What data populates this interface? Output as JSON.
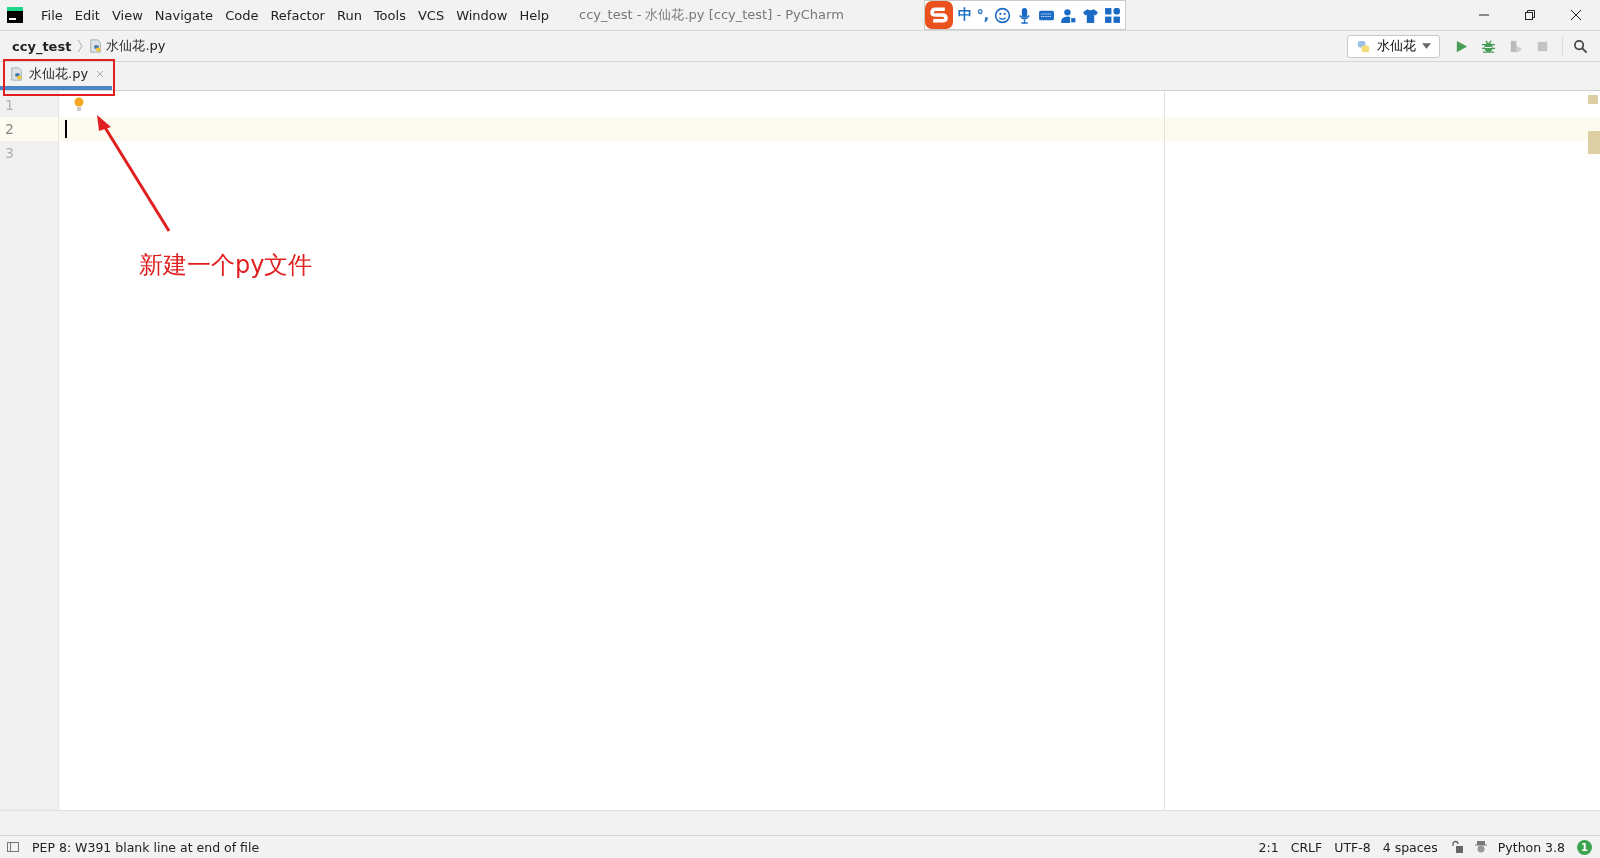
{
  "window": {
    "title": "ccy_test - 水仙花.py [ccy_test] - PyCharm"
  },
  "menu": [
    "File",
    "Edit",
    "View",
    "Navigate",
    "Code",
    "Refactor",
    "Run",
    "Tools",
    "VCS",
    "Window",
    "Help"
  ],
  "ime_toolbar": {
    "language": "中",
    "punctuation": "°,"
  },
  "breadcrumb": {
    "project": "ccy_test",
    "file": "水仙花.py"
  },
  "run_config": {
    "label": "水仙花"
  },
  "tabs": [
    {
      "label": "水仙花.py",
      "selected": true
    }
  ],
  "editor": {
    "lines": [
      {
        "number": "1",
        "current": false
      },
      {
        "number": "2",
        "current": true
      },
      {
        "number": "3",
        "current": false
      }
    ]
  },
  "annotation": {
    "caption": "新建一个py文件"
  },
  "status_bar": {
    "message": "PEP 8: W391 blank line at end of file",
    "items": [
      "2:1",
      "CRLF",
      "UTF-8",
      "4 spaces"
    ],
    "interpreter": "Python 3.8",
    "notifications": "1"
  }
}
